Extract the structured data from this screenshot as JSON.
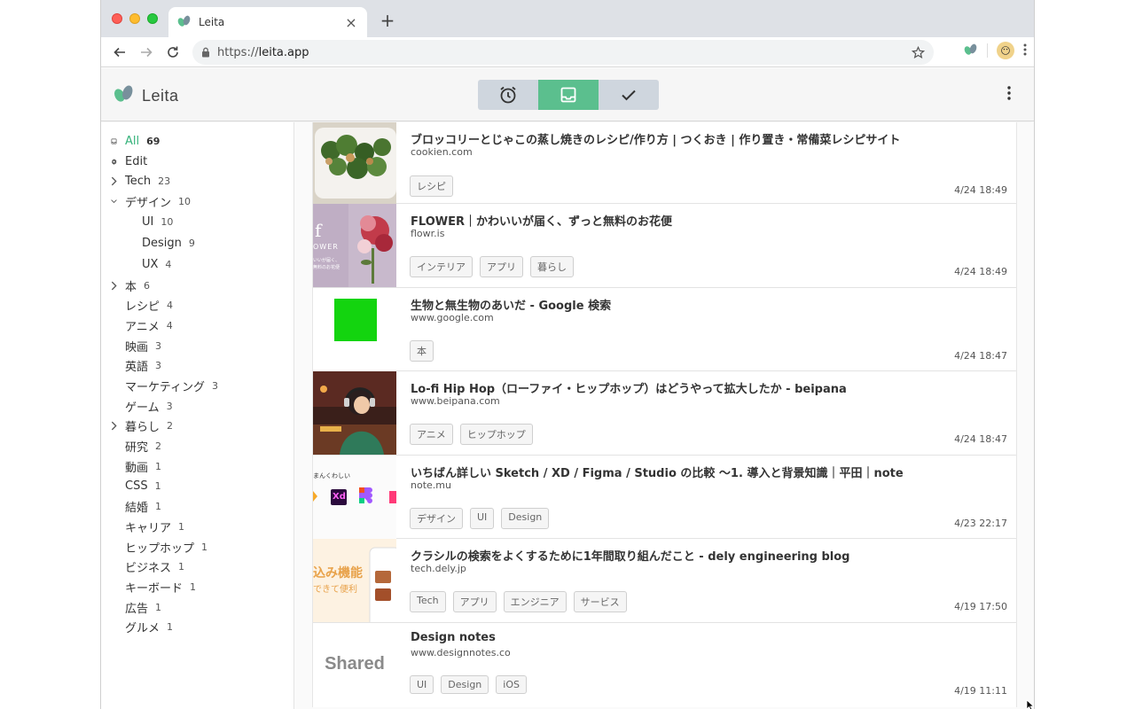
{
  "browser": {
    "tab_title": "Leita",
    "url_prefix": "https://",
    "url_host": "leita.app"
  },
  "app": {
    "brand": "Leita",
    "accent_color": "#5bbf8e",
    "segments": [
      {
        "icon": "alarm-clock-icon",
        "active": false
      },
      {
        "icon": "inbox-icon",
        "active": true
      },
      {
        "icon": "check-icon",
        "active": false
      }
    ]
  },
  "sidebar": {
    "items": [
      {
        "label": "All",
        "count": "69",
        "icon": "inbox-icon"
      },
      {
        "label": "Edit",
        "count": "",
        "icon": "gear-icon"
      },
      {
        "label": "Tech",
        "count": "23",
        "icon": "chevron-right-icon"
      },
      {
        "label": "デザイン",
        "count": "10",
        "icon": "chevron-down-icon"
      },
      {
        "label": "UI",
        "count": "10"
      },
      {
        "label": "Design",
        "count": "9"
      },
      {
        "label": "UX",
        "count": "4"
      },
      {
        "label": "本",
        "count": "6",
        "icon": "chevron-right-icon"
      },
      {
        "label": "レシピ",
        "count": "4"
      },
      {
        "label": "アニメ",
        "count": "4"
      },
      {
        "label": "映画",
        "count": "3"
      },
      {
        "label": "英語",
        "count": "3"
      },
      {
        "label": "マーケティング",
        "count": "3"
      },
      {
        "label": "ゲーム",
        "count": "3"
      },
      {
        "label": "暮らし",
        "count": "2",
        "icon": "chevron-right-icon"
      },
      {
        "label": "研究",
        "count": "2"
      },
      {
        "label": "動画",
        "count": "1"
      },
      {
        "label": "CSS",
        "count": "1"
      },
      {
        "label": "結婚",
        "count": "1"
      },
      {
        "label": "キャリア",
        "count": "1"
      },
      {
        "label": "ヒップホップ",
        "count": "1"
      },
      {
        "label": "ビジネス",
        "count": "1"
      },
      {
        "label": "キーボード",
        "count": "1"
      },
      {
        "label": "広告",
        "count": "1"
      },
      {
        "label": "グルメ",
        "count": "1"
      }
    ]
  },
  "cards": [
    {
      "title": "ブロッコリーとじゃこの蒸し焼きのレシピ/作り方 | つくおき | 作り置き・常備菜レシピサイト",
      "domain": "cookien.com",
      "tags": [
        "レシピ"
      ],
      "date": "4/24 18:49"
    },
    {
      "title": "FLOWER｜かわいいが届く、ずっと無料のお花便",
      "domain": "flowr.is",
      "tags": [
        "インテリア",
        "アプリ",
        "暮らし"
      ],
      "date": "4/24 18:49"
    },
    {
      "title": "生物と無生物のあいだ - Google 検索",
      "domain": "www.google.com",
      "tags": [
        "本"
      ],
      "date": "4/24 18:47"
    },
    {
      "title": "Lo-fi Hip Hop（ローファイ・ヒップホップ）はどうやって拡大したか - beipana",
      "domain": "www.beipana.com",
      "tags": [
        "アニメ",
        "ヒップホップ"
      ],
      "date": "4/24 18:47"
    },
    {
      "title": "いちばん詳しい Sketch / XD / Figma / Studio の比較 〜1. 導入と背景知識｜平田｜note",
      "domain": "note.mu",
      "tags": [
        "デザイン",
        "UI",
        "Design"
      ],
      "date": "4/23 22:17"
    },
    {
      "title": "クラシルの検索をよくするために1年間取り組んだこと - dely engineering blog",
      "domain": "tech.dely.jp",
      "tags": [
        "Tech",
        "アプリ",
        "エンジニア",
        "サービス"
      ],
      "date": "4/19 17:50"
    },
    {
      "title": "Design notes",
      "domain": "www.designnotes.co",
      "tags": [
        "UI",
        "Design",
        "iOS"
      ],
      "date": "4/19 11:11"
    }
  ],
  "thumb_text": {
    "flower_logo": "f",
    "flower_word": "OWER",
    "flower_caption1": "いいが届く、",
    "flower_caption2": "無料のお花便",
    "note_caption": "まんくわしい",
    "note_xd": "Xd",
    "kurashiru_1": "込み機能",
    "kurashiru_2": "できて便利",
    "shared": "Shared"
  }
}
